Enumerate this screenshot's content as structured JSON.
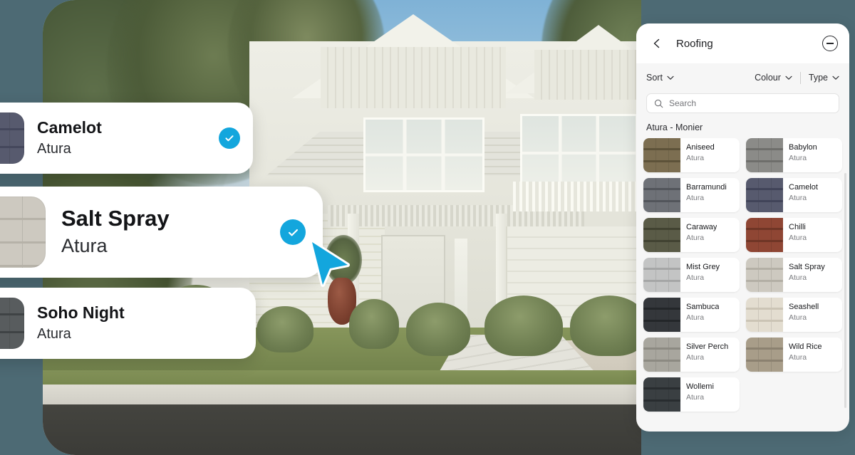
{
  "theme": {
    "background": "#4d6a74",
    "accent": "#13a6dd",
    "panel_bg": "#f6f6f6",
    "card_bg": "#ffffff"
  },
  "panel": {
    "title": "Roofing",
    "back_icon": "chevron-left-icon",
    "minimise_icon": "minus-circle-icon",
    "filters": {
      "sort_label": "Sort",
      "colour_label": "Colour",
      "type_label": "Type",
      "chevron_icon": "chevron-down-icon"
    },
    "search": {
      "placeholder": "Search",
      "value": "",
      "icon": "search-icon"
    },
    "group_title": "Atura - Monier",
    "tiles": [
      {
        "name": "Aniseed",
        "brand": "Atura",
        "color": "#7c6e51",
        "shade": "#5d5239"
      },
      {
        "name": "Babylon",
        "brand": "Atura",
        "color": "#8b8b88",
        "shade": "#6e6e6b"
      },
      {
        "name": "Barramundi",
        "brand": "Atura",
        "color": "#6e7177",
        "shade": "#52555b"
      },
      {
        "name": "Camelot",
        "brand": "Atura",
        "color": "#575a6e",
        "shade": "#414459"
      },
      {
        "name": "Caraway",
        "brand": "Atura",
        "color": "#5a5b47",
        "shade": "#414231"
      },
      {
        "name": "Chilli",
        "brand": "Atura",
        "color": "#8f4634",
        "shade": "#6f3526"
      },
      {
        "name": "Mist Grey",
        "brand": "Atura",
        "color": "#c3c4c4",
        "shade": "#a5a6a6"
      },
      {
        "name": "Salt Spray",
        "brand": "Atura",
        "color": "#cdc9c0",
        "shade": "#b3afa5"
      },
      {
        "name": "Sambuca",
        "brand": "Atura",
        "color": "#34373b",
        "shade": "#232629"
      },
      {
        "name": "Seashell",
        "brand": "Atura",
        "color": "#e3ddd0",
        "shade": "#cbc4b5"
      },
      {
        "name": "Silver Perch",
        "brand": "Atura",
        "color": "#a8a69e",
        "shade": "#8c8a82"
      },
      {
        "name": "Wild Rice",
        "brand": "Atura",
        "color": "#a89d89",
        "shade": "#8b8170"
      },
      {
        "name": "Wollemi",
        "brand": "Atura",
        "color": "#3a3f42",
        "shade": "#282c2f"
      }
    ]
  },
  "overlay_cards": [
    {
      "name": "Camelot",
      "brand": "Atura",
      "selected": true,
      "check_icon": "check-circle-icon",
      "swatch_color": "#575a6e",
      "swatch_shade": "#44475c"
    },
    {
      "name": "Salt Spray",
      "brand": "Atura",
      "selected": true,
      "check_icon": "check-circle-icon",
      "swatch_color": "#cdc9c0",
      "swatch_shade": "#b6b2a8"
    },
    {
      "name": "Soho Night",
      "brand": "Atura",
      "selected": false,
      "check_icon": "check-circle-icon",
      "swatch_color": "#585c5e",
      "swatch_shade": "#3f4345"
    }
  ],
  "cursor": {
    "icon": "pointer-cursor",
    "color": "#13a6dd"
  }
}
